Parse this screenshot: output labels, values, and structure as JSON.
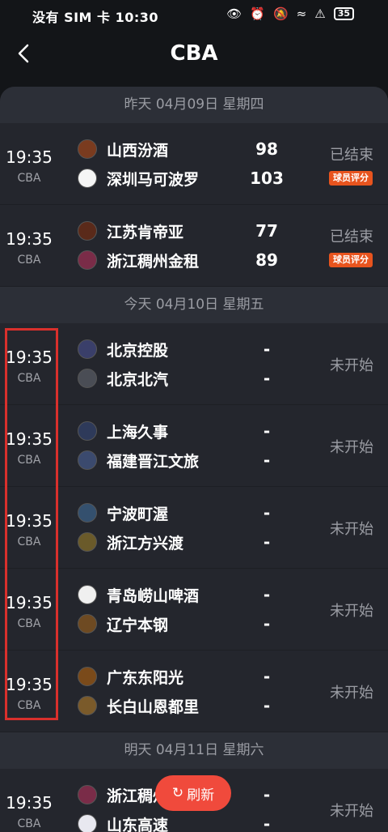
{
  "status_bar": {
    "left_text": "没有 SIM 卡 10:30",
    "battery": "35"
  },
  "header": {
    "title": "CBA"
  },
  "sections": [
    {
      "date_label": "昨天 04月09日 星期四"
    },
    {
      "date_label": "今天 04月10日 星期五"
    },
    {
      "date_label": "明天 04月11日 星期六"
    }
  ],
  "matches": [
    {
      "time": "19:35",
      "league": "CBA",
      "home": "山西汾酒",
      "away": "深圳马可波罗",
      "home_score": "98",
      "away_score": "103",
      "status": "已结束",
      "rating_label": "球员评分"
    },
    {
      "time": "19:35",
      "league": "CBA",
      "home": "江苏肯帝亚",
      "away": "浙江稠州金租",
      "home_score": "77",
      "away_score": "89",
      "status": "已结束",
      "rating_label": "球员评分"
    },
    {
      "time": "19:35",
      "league": "CBA",
      "home": "北京控股",
      "away": "北京北汽",
      "home_score": "-",
      "away_score": "-",
      "status": "未开始"
    },
    {
      "time": "19:35",
      "league": "CBA",
      "home": "上海久事",
      "away": "福建晋江文旅",
      "home_score": "-",
      "away_score": "-",
      "status": "未开始"
    },
    {
      "time": "19:35",
      "league": "CBA",
      "home": "宁波町渥",
      "away": "浙江方兴渡",
      "home_score": "-",
      "away_score": "-",
      "status": "未开始"
    },
    {
      "time": "19:35",
      "league": "CBA",
      "home": "青岛崂山啤酒",
      "away": "辽宁本钢",
      "home_score": "-",
      "away_score": "-",
      "status": "未开始"
    },
    {
      "time": "19:35",
      "league": "CBA",
      "home": "广东东阳光",
      "away": "长白山恩都里",
      "home_score": "-",
      "away_score": "-",
      "status": "未开始"
    },
    {
      "time": "19:35",
      "league": "CBA",
      "home": "浙江稠州",
      "away": "山东高速",
      "home_score": "-",
      "away_score": "-",
      "status": "未开始"
    }
  ],
  "refresh_button": {
    "label": "刷新"
  }
}
